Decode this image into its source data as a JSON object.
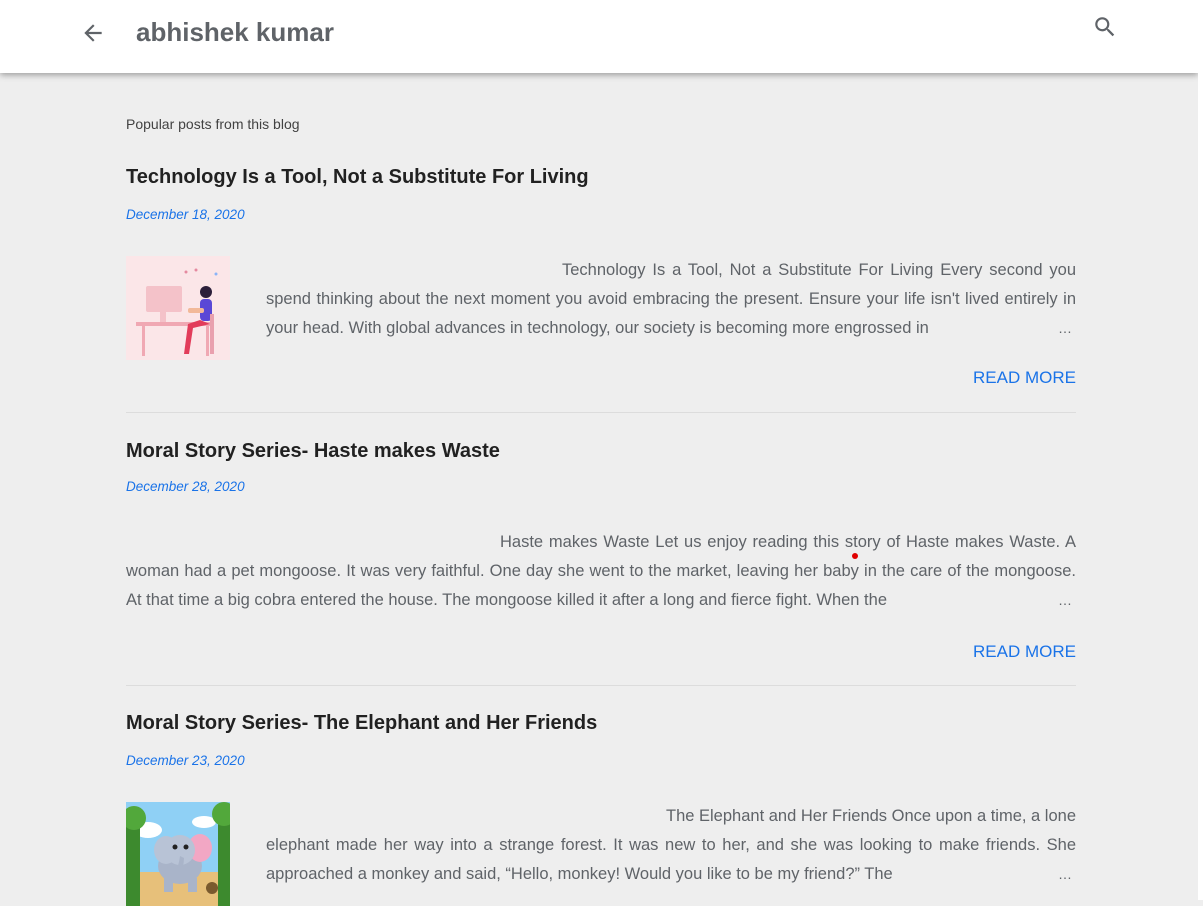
{
  "header": {
    "title": "abhishek kumar",
    "back_icon": "arrow-left-icon",
    "search_icon": "search-icon"
  },
  "section_title": "Popular posts from this blog",
  "posts": [
    {
      "title": "Technology Is a Tool, Not a Substitute For Living",
      "date": "December 18, 2020",
      "thumbnail": "person-at-desk-illustration",
      "snippet": "Technology Is a Tool, Not a Substitute For Living Every second you spend thinking about the next moment you avoid embracing the present. Ensure your life isn't lived entirely in your head. With global advances in technology, our society is becoming more engrossed in",
      "read_more": "READ MORE"
    },
    {
      "title": "Moral Story Series- Haste makes Waste",
      "date": "December 28, 2020",
      "snippet": "Haste makes Waste Let us enjoy reading this story of Haste makes Waste. A woman had a pet mongoose. It was very faithful. One day she went to the market, leaving her baby in the care of the mongoose. At that time a big cobra entered the house. The mongoose killed it after a long and fierce fight. When the",
      "read_more": "READ MORE"
    },
    {
      "title": "Moral Story Series- The Elephant and Her Friends",
      "date": "December 23, 2020",
      "thumbnail": "elephant-cartoon-illustration",
      "snippet": "The Elephant and Her Friends Once upon a time, a lone elephant made her way into a strange forest. It was new to her, and she was looking to make friends. She approached a monkey and said, “Hello, monkey! Would you like to be my friend?” The"
    }
  ],
  "ellipsis": "…",
  "colors": {
    "accent": "#1a73e8",
    "background": "#eeeeee",
    "header_bg": "#ffffff",
    "snippet_text": "#5f6368"
  }
}
